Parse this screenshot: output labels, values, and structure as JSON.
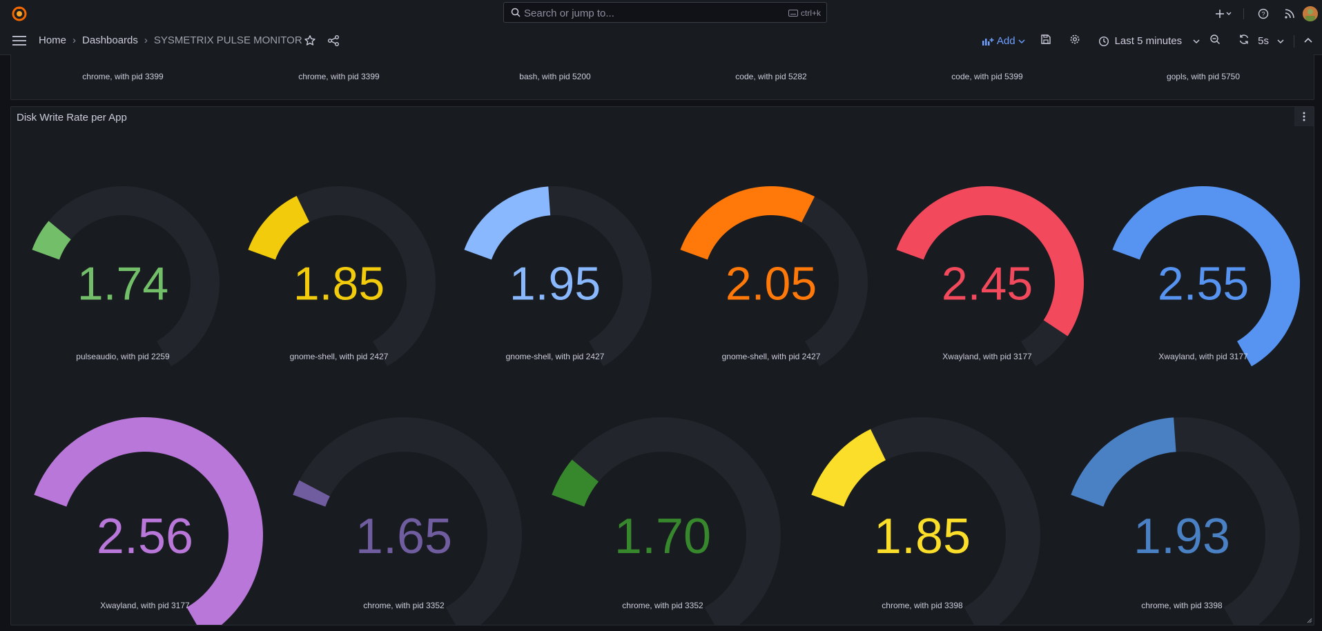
{
  "search": {
    "placeholder": "Search or jump to...",
    "shortcut": "ctrl+k"
  },
  "breadcrumb": {
    "home": "Home",
    "dashboards": "Dashboards",
    "current": "SYSMETRIX PULSE MONITOR"
  },
  "toolbar": {
    "add_label": "Add",
    "time_range": "Last 5 minutes",
    "refresh_interval": "5s"
  },
  "top_row_labels": [
    "chrome, with pid 3399",
    "chrome, with pid 3399",
    "bash, with pid 5200",
    "code, with pid 5282",
    "code, with pid 5399",
    "gopls, with pid 5750"
  ],
  "panel": {
    "title": "Disk Write Rate per App"
  },
  "gauge_range": {
    "min": 1.6,
    "max": 2.56
  },
  "gauges_row1": [
    {
      "value": "1.74",
      "label": "pulseaudio, with pid 2259",
      "color": "#73bf69",
      "fraction": 0.09
    },
    {
      "value": "1.85",
      "label": "gnome-shell, with pid 2427",
      "color": "#f2cc0c",
      "fraction": 0.2
    },
    {
      "value": "1.95",
      "label": "gnome-shell, with pid 2427",
      "color": "#8ab8ff",
      "fraction": 0.3
    },
    {
      "value": "2.05",
      "label": "gnome-shell, with pid 2427",
      "color": "#ff780a",
      "fraction": 0.44
    },
    {
      "value": "2.45",
      "label": "Xwayland, with pid 3177",
      "color": "#f2495c",
      "fraction": 0.88
    },
    {
      "value": "2.55",
      "label": "Xwayland, with pid 3177",
      "color": "#5794f2",
      "fraction": 1.0
    }
  ],
  "gauges_row2": [
    {
      "value": "2.56",
      "label": "Xwayland, with pid 3177",
      "color": "#b877d9",
      "fraction": 1.0
    },
    {
      "value": "1.65",
      "label": "chrome, with pid 3352",
      "color": "#705da0",
      "fraction": 0.0
    },
    {
      "value": "1.70",
      "label": "chrome, with pid 3352",
      "color": "#37872d",
      "fraction": 0.09
    },
    {
      "value": "1.85",
      "label": "chrome, with pid 3398",
      "color": "#fade2a",
      "fraction": 0.2
    },
    {
      "value": "1.93",
      "label": "chrome, with pid 3398",
      "color": "#4a80c4",
      "fraction": 0.3
    }
  ]
}
